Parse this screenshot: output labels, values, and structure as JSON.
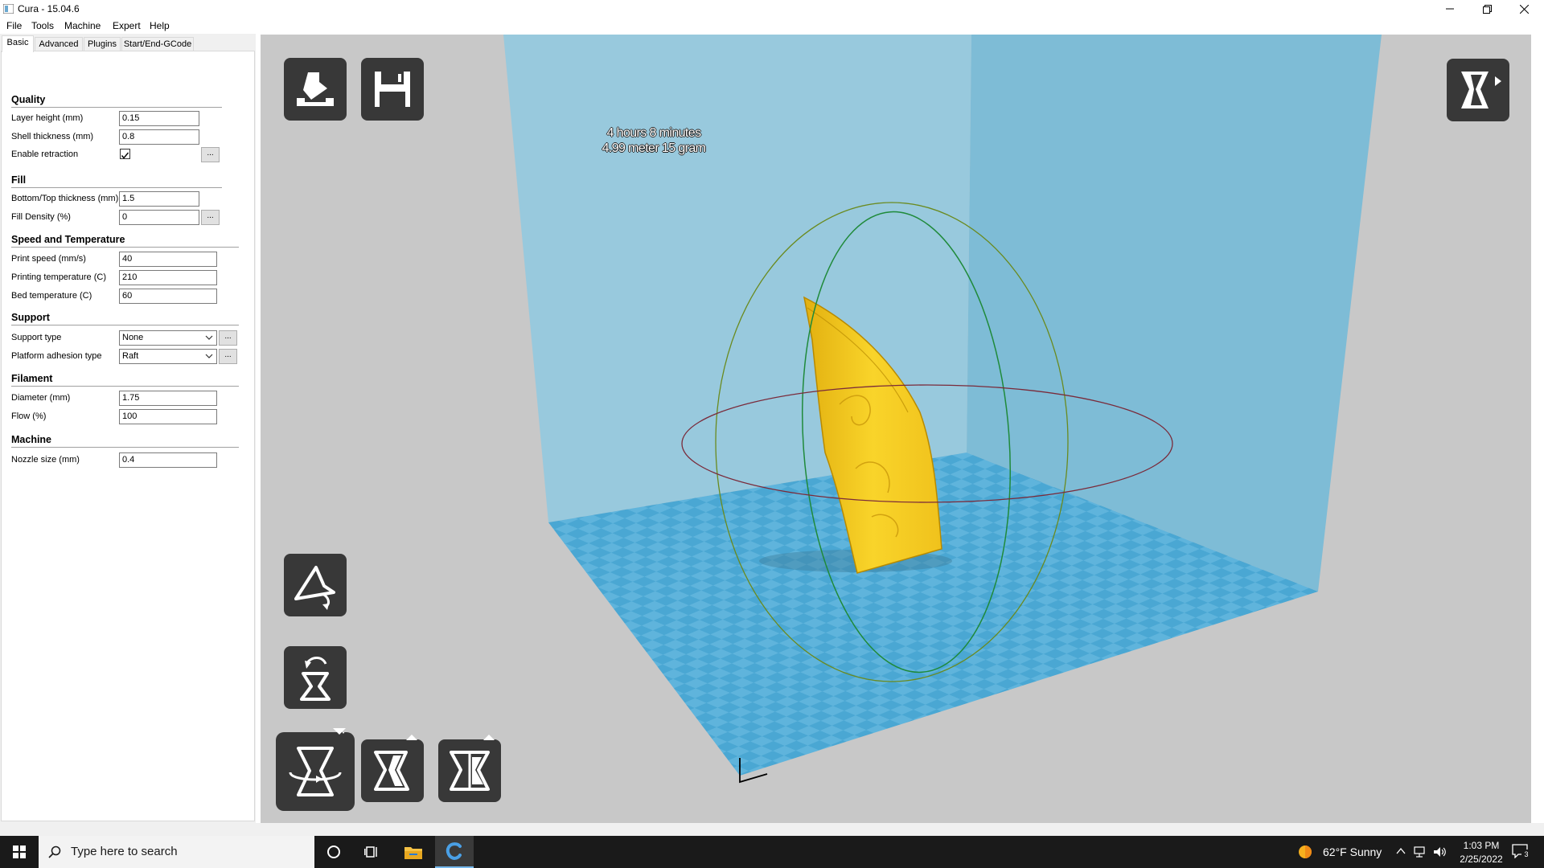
{
  "window": {
    "title": "Cura - 15.04.6"
  },
  "menu": [
    "File",
    "Tools",
    "Machine",
    "Expert",
    "Help"
  ],
  "tabs": [
    "Basic",
    "Advanced",
    "Plugins",
    "Start/End-GCode"
  ],
  "sections": {
    "quality": "Quality",
    "fill": "Fill",
    "speed": "Speed and Temperature",
    "support": "Support",
    "filament": "Filament",
    "machine": "Machine"
  },
  "fields": {
    "layer_height": {
      "label": "Layer height (mm)",
      "value": "0.15"
    },
    "shell_thickness": {
      "label": "Shell thickness (mm)",
      "value": "0.8"
    },
    "enable_retraction": {
      "label": "Enable retraction",
      "checked": true
    },
    "bottom_top_thickness": {
      "label": "Bottom/Top thickness (mm)",
      "value": "1.5"
    },
    "fill_density": {
      "label": "Fill Density (%)",
      "value": "0"
    },
    "print_speed": {
      "label": "Print speed (mm/s)",
      "value": "40"
    },
    "printing_temperature": {
      "label": "Printing temperature (C)",
      "value": "210"
    },
    "bed_temperature": {
      "label": "Bed temperature (C)",
      "value": "60"
    },
    "support_type": {
      "label": "Support type",
      "value": "None"
    },
    "platform_adhesion": {
      "label": "Platform adhesion type",
      "value": "Raft"
    },
    "diameter": {
      "label": "Diameter (mm)",
      "value": "1.75"
    },
    "flow": {
      "label": "Flow (%)",
      "value": "100"
    },
    "nozzle_size": {
      "label": "Nozzle size (mm)",
      "value": "0.4"
    }
  },
  "dots_label": "...",
  "print_info": {
    "time": "4 hours 8 minutes",
    "material": "4.99 meter 15 gram"
  },
  "taskbar": {
    "search_placeholder": "Type here to search",
    "weather": "62°F  Sunny",
    "time": "1:03 PM",
    "date": "2/25/2022",
    "notification_count": "3"
  },
  "colors": {
    "viewport_bg": "#c8c8c8",
    "build_volume_back": "#93c7dc",
    "build_volume_right": "#7fbdd6",
    "platform": "#5fb4dc",
    "model": "#f2c51e",
    "tool_button": "#383838"
  },
  "icons": [
    "load-icon",
    "save-icon",
    "view-mode-icon",
    "rotate-icon",
    "scale-icon",
    "mirror-icon",
    "lay-flat-icon",
    "reset-icon",
    "cortana-icon",
    "task-view-icon",
    "file-explorer-icon",
    "cura-taskbar-icon"
  ]
}
